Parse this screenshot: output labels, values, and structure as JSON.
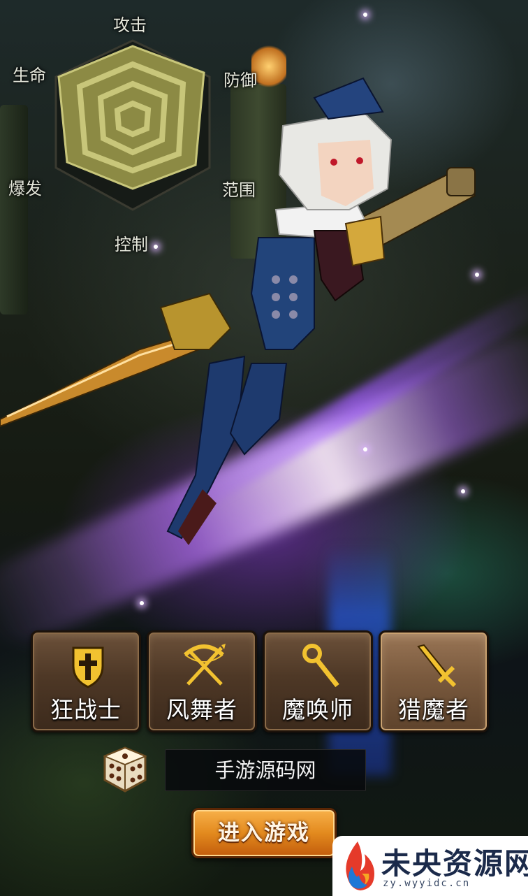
{
  "stats": {
    "attack": "攻击",
    "defense": "防御",
    "range": "范围",
    "control": "控制",
    "burst": "爆发",
    "life": "生命"
  },
  "classes": [
    {
      "label": "狂战士",
      "icon": "shield-cross-icon",
      "selected": false
    },
    {
      "label": "风舞者",
      "icon": "crossbow-icon",
      "selected": false
    },
    {
      "label": "魔唤师",
      "icon": "staff-icon",
      "selected": false
    },
    {
      "label": "猎魔者",
      "icon": "sword-icon",
      "selected": true
    }
  ],
  "name_row": {
    "dice_icon": "dice-icon",
    "name_value": "手游源码网"
  },
  "enter_button": {
    "label": "进入游戏"
  },
  "watermark": {
    "title": "未央资源网",
    "url": "zy.wyyidc.cn"
  },
  "colors": {
    "button_brown": "#4e3826",
    "button_selected": "#7a5a3e",
    "enter_orange": "#e38a1e",
    "radar_fill": "#8c8a44"
  }
}
